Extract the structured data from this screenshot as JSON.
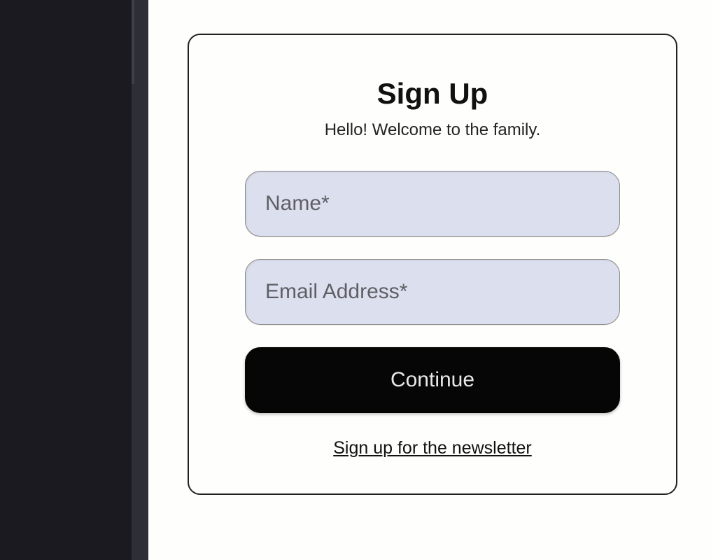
{
  "form": {
    "title": "Sign Up",
    "subtitle": "Hello! Welcome to the family.",
    "name_placeholder": "Name*",
    "email_placeholder": "Email Address*",
    "continue_label": "Continue",
    "newsletter_link": "Sign up for the newsletter"
  }
}
